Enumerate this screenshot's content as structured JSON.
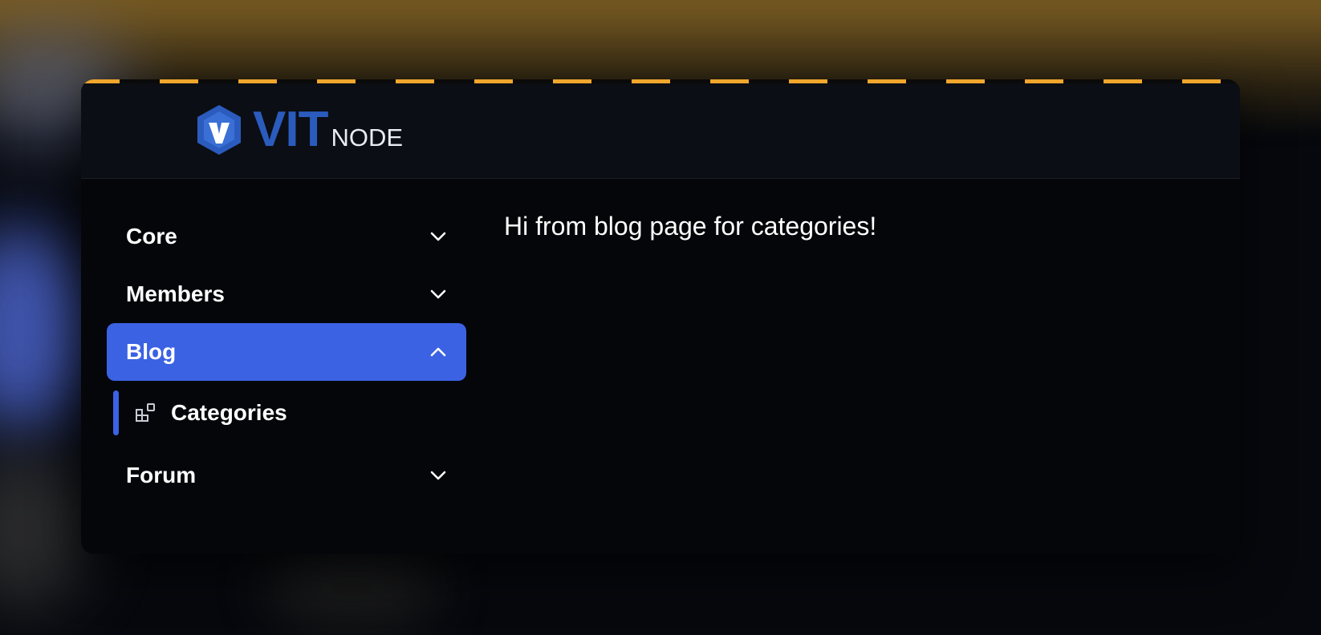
{
  "brand": {
    "name_main": "VIT",
    "name_sub": "NODE",
    "accent_color": "#2b5bbd"
  },
  "sidebar": {
    "items": [
      {
        "label": "Core",
        "icon": "chevron-down-icon"
      },
      {
        "label": "Members",
        "icon": "chevron-down-icon"
      },
      {
        "label": "Blog",
        "icon": "chevron-up-icon",
        "active": true
      },
      {
        "label": "Forum",
        "icon": "chevron-down-icon"
      }
    ],
    "blog_children": [
      {
        "label": "Categories",
        "icon": "categories-icon",
        "active": true
      }
    ],
    "active_color": "#3b62e3"
  },
  "main": {
    "message": "Hi from blog page for categories!"
  },
  "theme": {
    "stripe_color": "#f0a62c",
    "background": "#04060a"
  }
}
